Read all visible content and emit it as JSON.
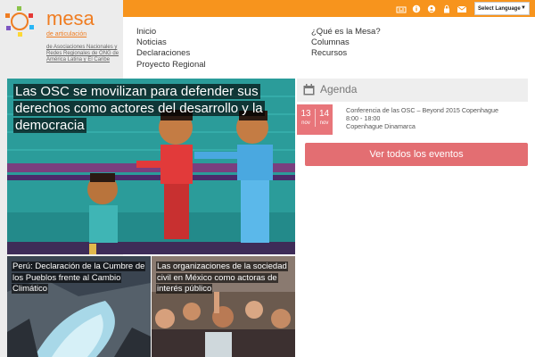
{
  "logo": {
    "title": "mesa",
    "subtitle": "de articulación",
    "description": "de Asociaciones Nacionales y Redes Regionales de ONG de América Latina y El Caribe"
  },
  "topbar": {
    "icons": [
      "home-icon",
      "info-icon",
      "people-icon",
      "lock-icon",
      "mail-icon"
    ],
    "language_label": "Select Language",
    "accent": "#f7941d"
  },
  "nav": {
    "col1": [
      "Inicio",
      "Noticias",
      "Declaraciones",
      "Proyecto Regional"
    ],
    "col2": [
      "¿Qué es la Mesa?",
      "Columnas",
      "Recursos"
    ]
  },
  "hero": {
    "title": "Las OSC se movilizan para defender sus derechos como actores del desarrollo y la democracia"
  },
  "tiles": [
    {
      "title": "Perú: Declaración de la Cumbre de los Pueblos frente al Cambio Climático"
    },
    {
      "title": "Las organizaciones de la sociedad civil en México como actoras de interés público"
    }
  ],
  "agenda": {
    "title": "Agenda",
    "event": {
      "day1": "13",
      "mon1": "nov",
      "day2": "14",
      "mon2": "nov",
      "name": "Conferencia de las OSC – Beyond 2015 Copenhague",
      "time": "8:00 - 18:00",
      "place": "Copenhague Dinamarca"
    },
    "all_events_label": "Ver todos los eventos",
    "accent": "#e36e72"
  }
}
